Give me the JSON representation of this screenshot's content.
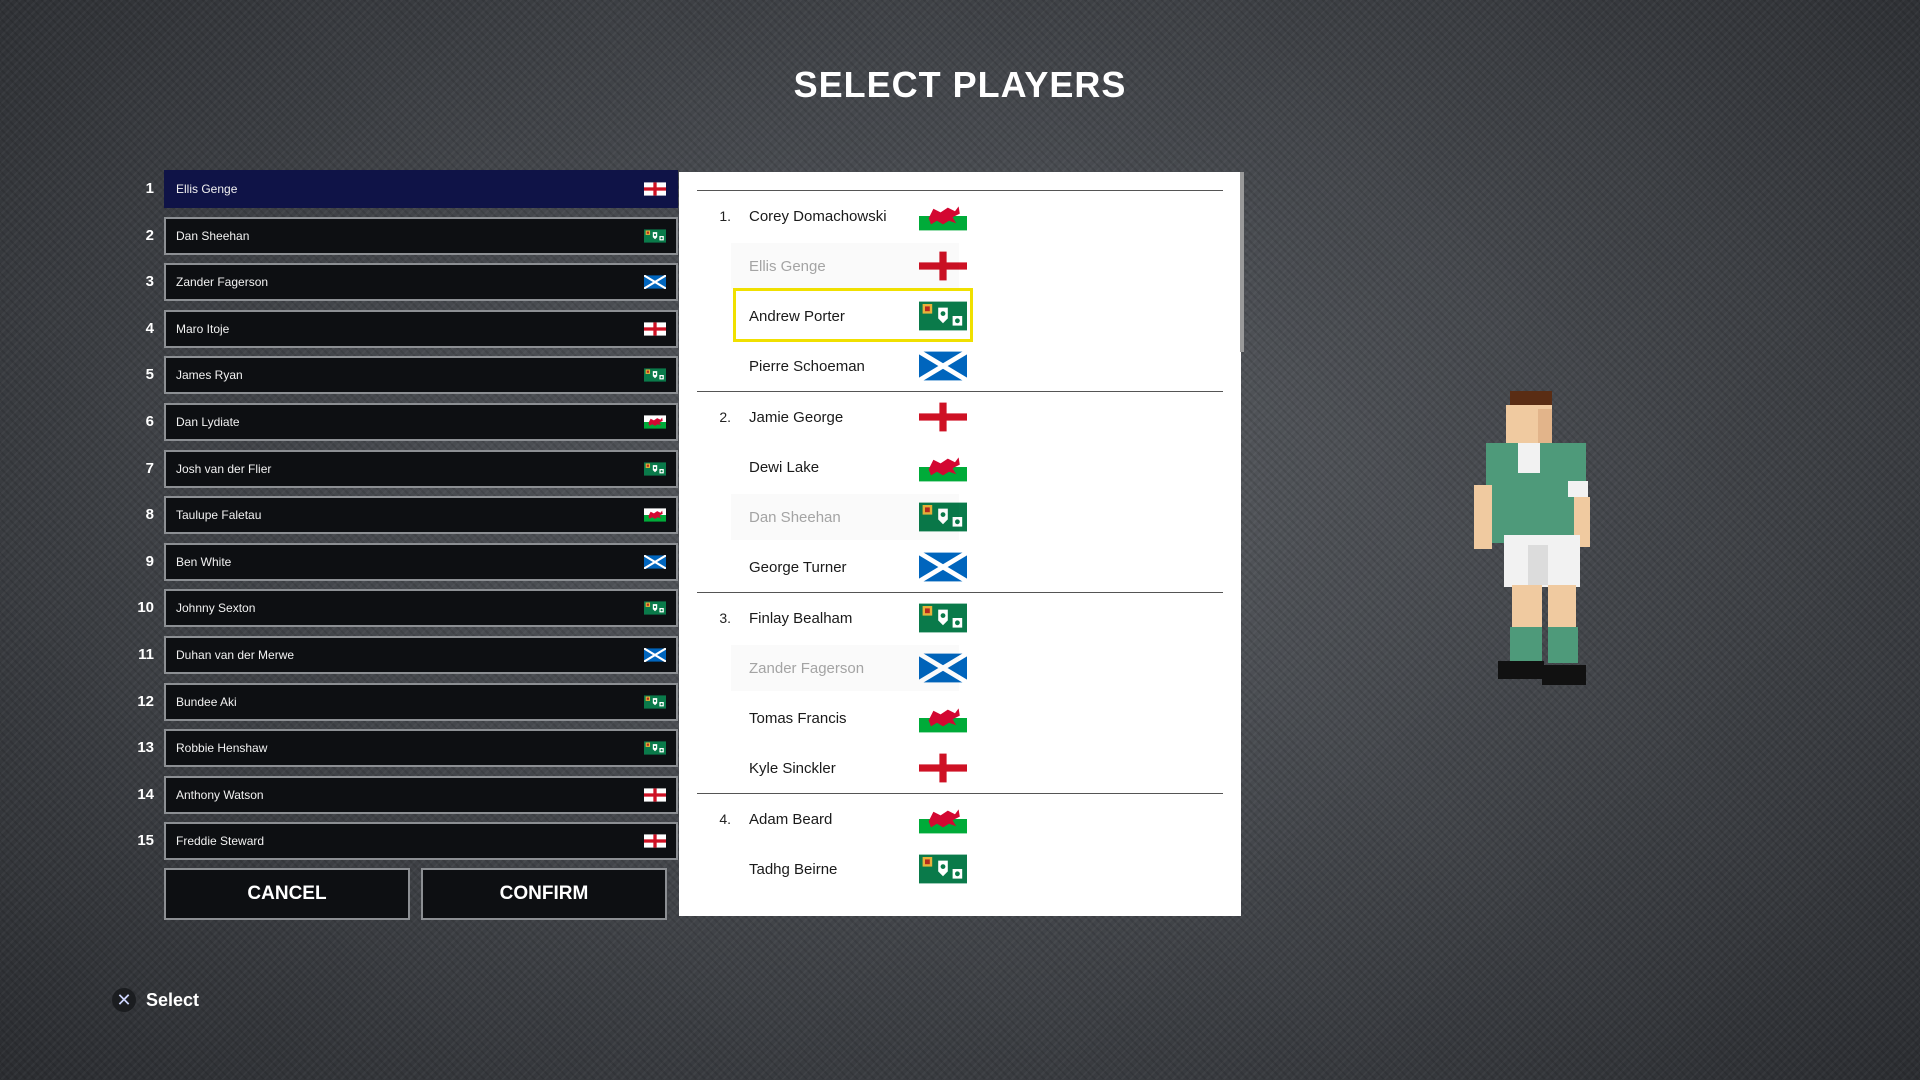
{
  "title": "SELECT PLAYERS",
  "squad": [
    {
      "num": "1",
      "name": "Ellis Genge",
      "flag": "england",
      "active": true
    },
    {
      "num": "2",
      "name": "Dan Sheehan",
      "flag": "ireland"
    },
    {
      "num": "3",
      "name": "Zander Fagerson",
      "flag": "scotland"
    },
    {
      "num": "4",
      "name": "Maro Itoje",
      "flag": "england"
    },
    {
      "num": "5",
      "name": "James Ryan",
      "flag": "ireland"
    },
    {
      "num": "6",
      "name": "Dan Lydiate",
      "flag": "wales"
    },
    {
      "num": "7",
      "name": "Josh van der Flier",
      "flag": "ireland"
    },
    {
      "num": "8",
      "name": "Taulupe Faletau",
      "flag": "wales"
    },
    {
      "num": "9",
      "name": "Ben White",
      "flag": "scotland"
    },
    {
      "num": "10",
      "name": "Johnny Sexton",
      "flag": "ireland"
    },
    {
      "num": "11",
      "name": "Duhan van der Merwe",
      "flag": "scotland"
    },
    {
      "num": "12",
      "name": "Bundee Aki",
      "flag": "ireland"
    },
    {
      "num": "13",
      "name": "Robbie Henshaw",
      "flag": "ireland"
    },
    {
      "num": "14",
      "name": "Anthony Watson",
      "flag": "england"
    },
    {
      "num": "15",
      "name": "Freddie Steward",
      "flag": "england"
    }
  ],
  "buttons": {
    "cancel": "CANCEL",
    "confirm": "CONFIRM"
  },
  "groups": [
    {
      "label": "1.",
      "players": [
        {
          "name": "Corey Domachowski",
          "flag": "wales"
        },
        {
          "name": "Ellis Genge",
          "flag": "england",
          "disabled": true
        },
        {
          "name": "Andrew Porter",
          "flag": "ireland",
          "selected": true
        },
        {
          "name": "Pierre Schoeman",
          "flag": "scotland"
        }
      ]
    },
    {
      "label": "2.",
      "players": [
        {
          "name": "Jamie George",
          "flag": "england"
        },
        {
          "name": "Dewi Lake",
          "flag": "wales"
        },
        {
          "name": "Dan Sheehan",
          "flag": "ireland",
          "disabled": true
        },
        {
          "name": "George Turner",
          "flag": "scotland"
        }
      ]
    },
    {
      "label": "3.",
      "players": [
        {
          "name": "Finlay Bealham",
          "flag": "ireland"
        },
        {
          "name": "Zander Fagerson",
          "flag": "scotland",
          "disabled": true
        },
        {
          "name": "Tomas Francis",
          "flag": "wales"
        },
        {
          "name": "Kyle Sinckler",
          "flag": "england"
        }
      ]
    },
    {
      "label": "4.",
      "players": [
        {
          "name": "Adam Beard",
          "flag": "wales"
        },
        {
          "name": "Tadhg Beirne",
          "flag": "ireland"
        }
      ]
    }
  ],
  "hint": {
    "icon": "cross-button-icon",
    "label": "Select"
  },
  "colors": {
    "active_row": "#0f1347",
    "selection": "#f0e000",
    "jersey": "#4e9a7a"
  }
}
